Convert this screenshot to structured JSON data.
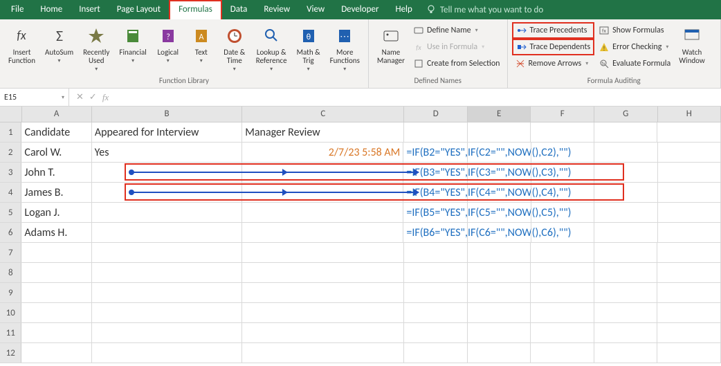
{
  "menubar": {
    "tabs": [
      "File",
      "Home",
      "Insert",
      "Page Layout",
      "Formulas",
      "Data",
      "Review",
      "View",
      "Developer",
      "Help"
    ],
    "active_index": 4,
    "tell_me": "Tell me what you want to do"
  },
  "ribbon": {
    "groups": {
      "function_library": {
        "label": "Function Library",
        "insert_function": "Insert\nFunction",
        "autosum": "AutoSum",
        "recently_used": "Recently\nUsed",
        "financial": "Financial",
        "logical": "Logical",
        "text": "Text",
        "date_time": "Date &\nTime",
        "lookup_ref": "Lookup &\nReference",
        "math_trig": "Math &\nTrig",
        "more_functions": "More\nFunctions"
      },
      "defined_names": {
        "label": "Defined Names",
        "name_manager": "Name\nManager",
        "define_name": "Define Name",
        "use_in_formula": "Use in Formula",
        "create_from_selection": "Create from Selection"
      },
      "formula_auditing": {
        "label": "Formula Auditing",
        "trace_precedents": "Trace Precedents",
        "trace_dependents": "Trace Dependents",
        "remove_arrows": "Remove Arrows",
        "show_formulas": "Show Formulas",
        "error_checking": "Error Checking",
        "evaluate_formula": "Evaluate Formula",
        "watch_window": "Watch\nWindow"
      }
    }
  },
  "formula_bar": {
    "name_box": "E15",
    "formula": ""
  },
  "grid": {
    "columns": [
      "A",
      "B",
      "C",
      "D",
      "E",
      "F",
      "G",
      "H"
    ],
    "row_numbers": [
      1,
      2,
      3,
      4,
      5,
      6,
      7,
      8,
      9,
      10,
      11,
      12
    ],
    "data": {
      "r1": {
        "A": "Candidate",
        "B": "Appeared for Interview",
        "C": "Manager Review"
      },
      "r2": {
        "A": "Carol W.",
        "B": "Yes",
        "C": "2/7/23  5:58 AM",
        "D": "=IF(B2=\"YES\",IF(C2=\"\",NOW(),C2),\"\")"
      },
      "r3": {
        "A": "John T.",
        "D": "=IF(B3=\"YES\",IF(C3=\"\",NOW(),C3),\"\")"
      },
      "r4": {
        "A": "James B.",
        "D": "=IF(B4=\"YES\",IF(C4=\"\",NOW(),C4),\"\")"
      },
      "r5": {
        "A": "Logan J.",
        "D": "=IF(B5=\"YES\",IF(C5=\"\",NOW(),C5),\"\")"
      },
      "r6": {
        "A": "Adams H.",
        "D": "=IF(B6=\"YES\",IF(C6=\"\",NOW(),C6),\"\")"
      }
    }
  },
  "colors": {
    "excel_green": "#217346",
    "highlight_red": "#e03020",
    "formula_blue": "#1f6fc0",
    "date_orange": "#d97726"
  }
}
